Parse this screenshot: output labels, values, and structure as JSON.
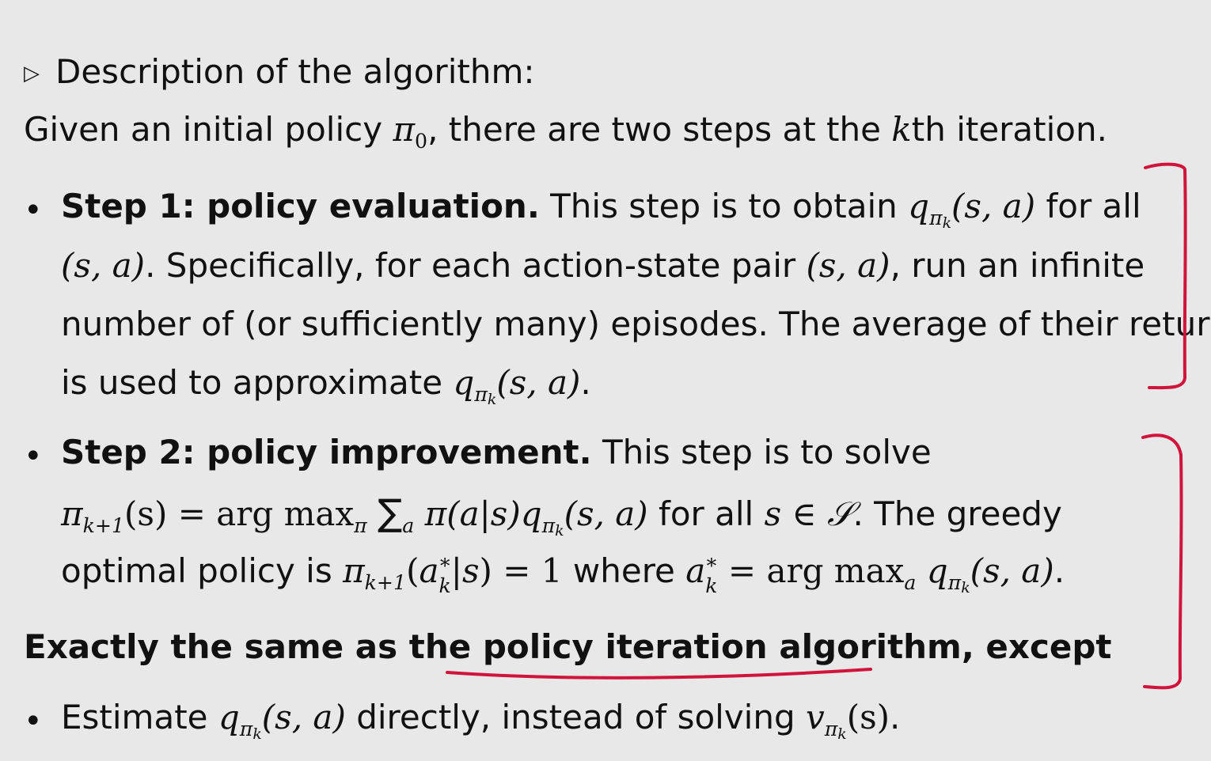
{
  "heading": {
    "marker": "▷",
    "text": "Description of the algorithm:"
  },
  "intro": {
    "before": "Given an initial policy ",
    "pi": "π",
    "pi_sub": "0",
    "middle": ", there are two steps at the ",
    "k": "k",
    "after": "th iteration."
  },
  "step1": {
    "bullet": "•",
    "title": "Step 1:  policy evaluation.",
    "line1_text": " This step is to obtain ",
    "line1_end": " for all",
    "line2_mid": ". Specifically, for each action-state pair ",
    "line2_end": ", run an infinite",
    "line3": "number of (or sufficiently many) episodes.  The average of their returns",
    "line4_text": "is used to approximate ",
    "line4_end": "."
  },
  "step2": {
    "bullet": "•",
    "title": "Step 2:  policy improvement.",
    "line1_text": " This step is to solve",
    "line2_mid": " for all ",
    "line2_set": "s ∈ 𝒮",
    "line2_end": ".  The greedy",
    "line3_text": "optimal policy is ",
    "line3_where": " where ",
    "line3_end": "."
  },
  "math": {
    "q": "q",
    "pi": "π",
    "k": "k",
    "sa": "(s, a)",
    "argmax": "arg max",
    "sum": "∑",
    "a": "a",
    "pi_a_s": "π(a|s)",
    "pi_k1": "k+1",
    "s_paren": "(s)",
    "eq": " = ",
    "one": "1",
    "star": "*",
    "v": "v"
  },
  "note": {
    "before": "Exactly the same as the ",
    "link": "policy iteration algorithm",
    "after": ", except"
  },
  "diff": {
    "bullet": "•",
    "before": "Estimate ",
    "middle": " directly, instead of solving ",
    "end": "."
  },
  "annotation_color": "#d0143c"
}
